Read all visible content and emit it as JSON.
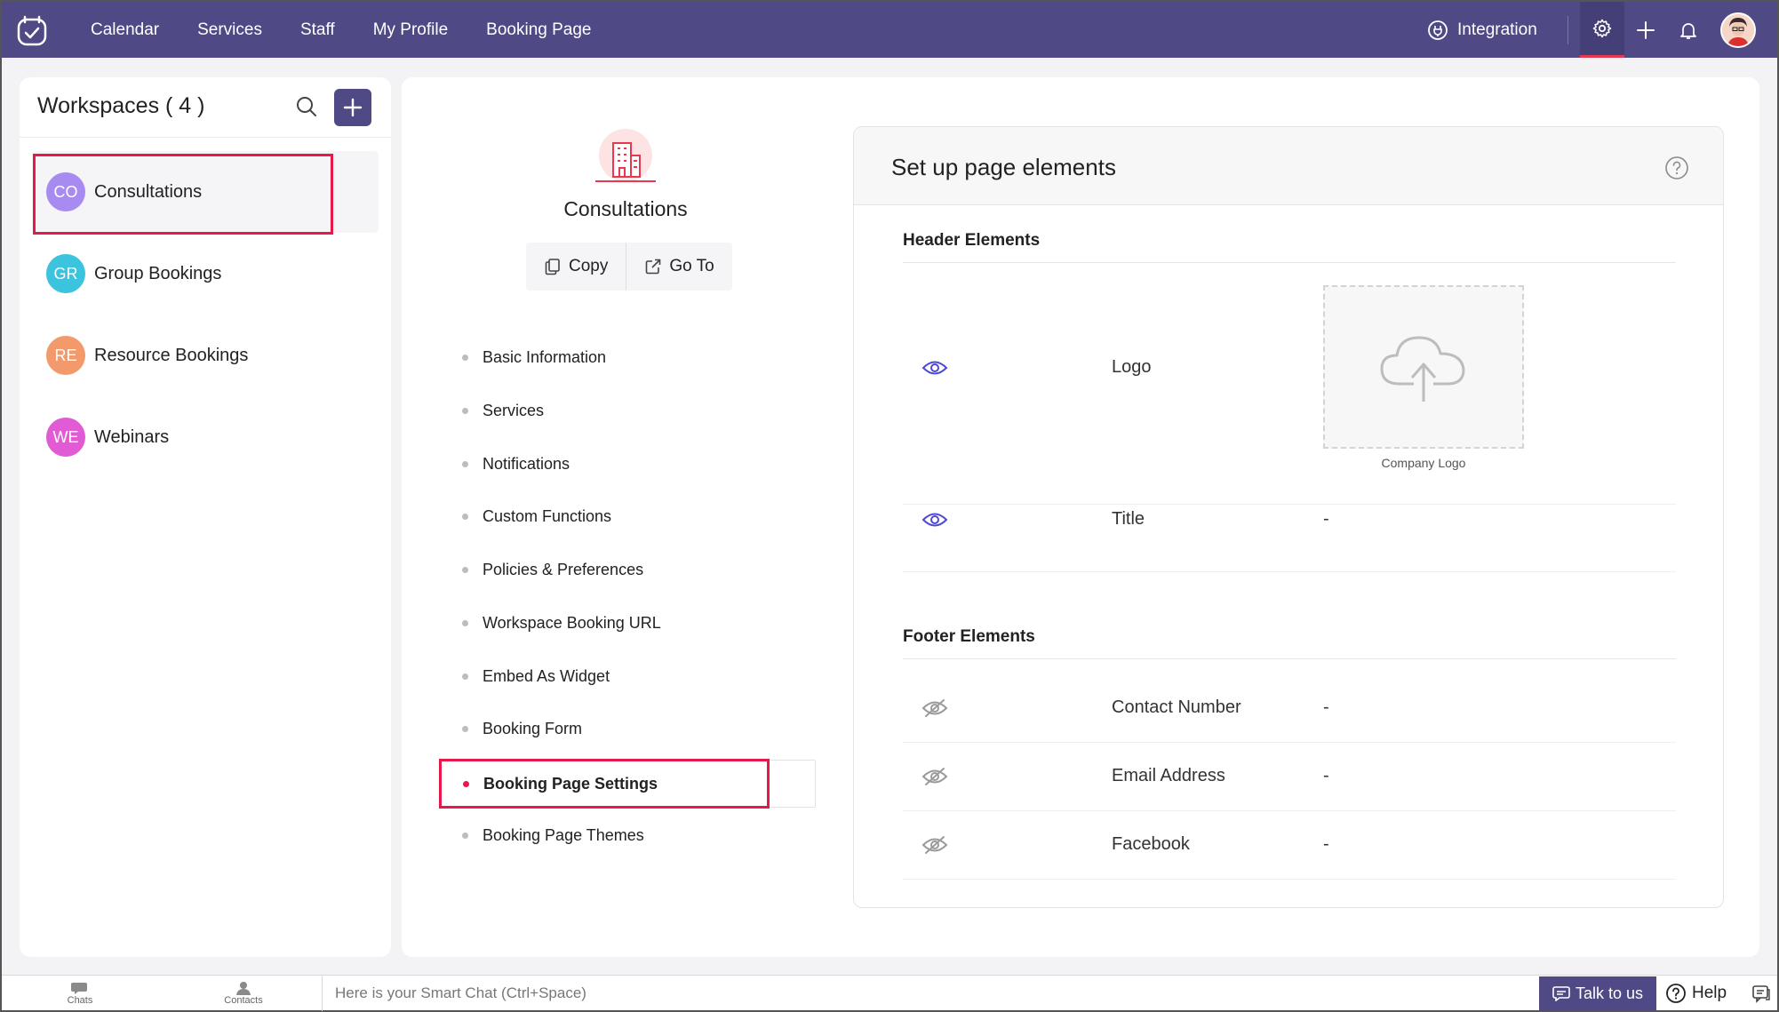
{
  "topbar": {
    "nav": [
      "Calendar",
      "Services",
      "Staff",
      "My Profile",
      "Booking Page"
    ],
    "integration_label": "Integration",
    "colors": {
      "bar": "#4f4a85",
      "active_underline": "#e8384f"
    }
  },
  "sidebar": {
    "title": "Workspaces ( 4 )",
    "items": [
      {
        "initials": "CO",
        "label": "Consultations",
        "color": "#a78bf0",
        "active": true
      },
      {
        "initials": "GR",
        "label": "Group Bookings",
        "color": "#3cc3dd",
        "active": false
      },
      {
        "initials": "RE",
        "label": "Resource Bookings",
        "color": "#f29a6b",
        "active": false
      },
      {
        "initials": "WE",
        "label": "Webinars",
        "color": "#e05bd4",
        "active": false
      }
    ]
  },
  "workspace": {
    "title": "Consultations",
    "copy_label": "Copy",
    "goto_label": "Go To",
    "menu": [
      "Basic Information",
      "Services",
      "Notifications",
      "Custom Functions",
      "Policies & Preferences",
      "Workspace Booking URL",
      "Embed As Widget",
      "Booking Form",
      "Booking Page Settings",
      "Booking Page Themes"
    ],
    "active_menu": "Booking Page Settings"
  },
  "panel": {
    "title": "Set up page elements",
    "header_section": "Header Elements",
    "header_rows": [
      {
        "label": "Logo",
        "value": "",
        "visible": true
      },
      {
        "label": "Title",
        "value": "-",
        "visible": true
      }
    ],
    "logo_caption": "Company Logo",
    "footer_section": "Footer Elements",
    "footer_rows": [
      {
        "label": "Contact Number",
        "value": "-",
        "visible": false
      },
      {
        "label": "Email Address",
        "value": "-",
        "visible": false
      },
      {
        "label": "Facebook",
        "value": "-",
        "visible": false
      }
    ]
  },
  "bottombar": {
    "chats_label": "Chats",
    "contacts_label": "Contacts",
    "smartchat_placeholder": "Here is your Smart Chat (Ctrl+Space)",
    "talk_label": "Talk to us",
    "help_label": "Help"
  }
}
